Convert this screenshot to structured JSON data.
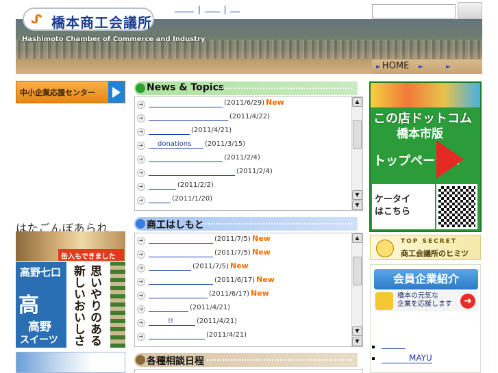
{
  "header": {
    "logo_mark": "ᔑ",
    "logo_text": "橋本商工会議所",
    "english_name": "Hashimoto Chamber of Commerce and Industry",
    "top_links": [
      "",
      "|",
      "",
      "|",
      ""
    ],
    "search_placeholder": "",
    "nav": [
      {
        "label": "HOME"
      },
      {
        "label": ""
      },
      {
        "label": ""
      }
    ]
  },
  "left": {
    "support_banner": "中小企業応援センター",
    "hata_title": "はたごんぼあられ",
    "hata_sign": "缶入もできました",
    "sweets_line1": "高野七口",
    "sweets_mark": "高",
    "sweets_line2": "高野",
    "sweets_line3": "スイーツ",
    "sweets_vertical": [
      "思いやりのある",
      "新しいおいしさ"
    ]
  },
  "news": {
    "title": "News & Topics",
    "items": [
      {
        "link": "",
        "date": "(2011/6/29)",
        "new": "New"
      },
      {
        "link": "",
        "date": "(2011/4/22)",
        "new": ""
      },
      {
        "link": "",
        "date": "(2011/4/21)",
        "new": ""
      },
      {
        "link": "donations",
        "date": "(2011/3/15)",
        "new": ""
      },
      {
        "link": "",
        "date": "(2011/2/4)",
        "new": ""
      },
      {
        "link": "",
        "date": "(2011/2/4)",
        "new": ""
      },
      {
        "link": "",
        "date": "(2011/2/2)",
        "new": ""
      },
      {
        "link": "",
        "date": "(2011/1/20)",
        "new": ""
      }
    ]
  },
  "shoko": {
    "title": "商工はしもと",
    "items": [
      {
        "link": "",
        "date": "(2011/7/5)",
        "new": "New"
      },
      {
        "link": "",
        "date": "(2011/7/5)",
        "new": "New"
      },
      {
        "link": "",
        "date": "(2011/7/5)",
        "new": "New"
      },
      {
        "link": "",
        "date": "(2011/6/17)",
        "new": "New"
      },
      {
        "link": "",
        "date": "(2011/6/17)",
        "new": "New"
      },
      {
        "link": "",
        "date": "(2011/4/21)",
        "new": ""
      },
      {
        "link": "!!",
        "date": "(2011/4/21)",
        "new": ""
      },
      {
        "link": "",
        "date": "(2011/4/21)",
        "new": ""
      }
    ]
  },
  "soudan": {
    "title": "各種相談日程"
  },
  "right": {
    "shop_line1": "この店ドットコム",
    "shop_line2": "橋本市版",
    "shop_line3": "トップページへ",
    "mobile_label": "ケータイ\nはこちら",
    "secret_line1": "TOP SECRET",
    "secret_line2": "商工会議所のヒミツ",
    "member_title": "会員企業紹介",
    "member_sub": "橋本の元気な\n企業を応援します",
    "links": [
      "",
      "MAYU"
    ]
  },
  "colors": {
    "brand_blue": "#1c3d8f",
    "new_orange": "#ff6a00",
    "link": "#1a3fa0"
  }
}
